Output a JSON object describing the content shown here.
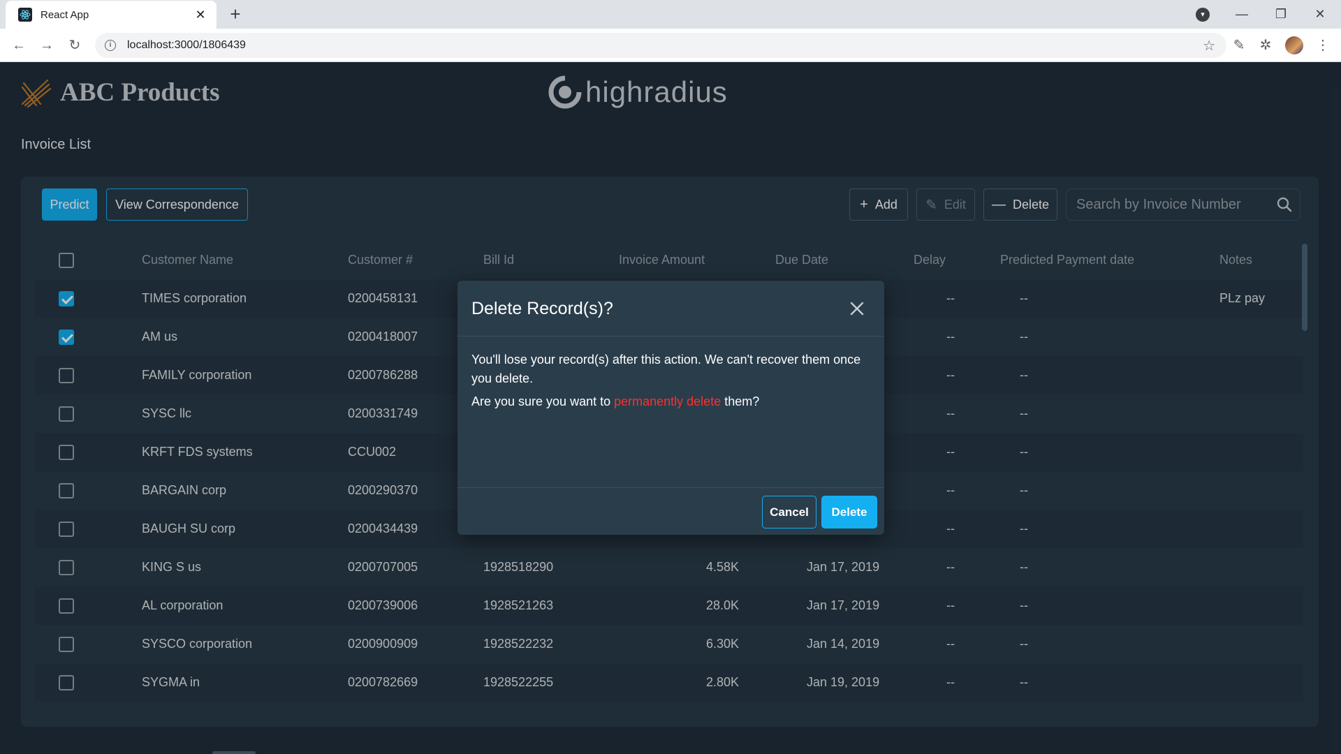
{
  "browser": {
    "tab_title": "React App",
    "url": "localhost:3000/1806439"
  },
  "app": {
    "company_name": "ABC Products",
    "partner_logo_text": "highradius",
    "page_title": "Invoice List"
  },
  "toolbar": {
    "predict_label": "Predict",
    "view_correspondence_label": "View Correspondence",
    "add_label": "Add",
    "edit_label": "Edit",
    "delete_label": "Delete",
    "search_placeholder": "Search by Invoice Number"
  },
  "table": {
    "headers": {
      "customer_name": "Customer Name",
      "customer_number": "Customer #",
      "bill_id": "Bill Id",
      "invoice_amount": "Invoice Amount",
      "due_date": "Due Date",
      "delay": "Delay",
      "predicted_payment_date": "Predicted Payment date",
      "notes": "Notes"
    },
    "rows": [
      {
        "checked": true,
        "customer_name": "TIMES corporation",
        "customer_number": "0200458131",
        "bill_id": "",
        "amount": "",
        "due_date": "",
        "delay": "--",
        "predicted": "--",
        "notes": "PLz pay"
      },
      {
        "checked": true,
        "customer_name": "AM us",
        "customer_number": "0200418007",
        "bill_id": "",
        "amount": "",
        "due_date": "",
        "delay": "--",
        "predicted": "--",
        "notes": ""
      },
      {
        "checked": false,
        "customer_name": "FAMILY corporation",
        "customer_number": "0200786288",
        "bill_id": "",
        "amount": "",
        "due_date": "",
        "delay": "--",
        "predicted": "--",
        "notes": ""
      },
      {
        "checked": false,
        "customer_name": "SYSC llc",
        "customer_number": "0200331749",
        "bill_id": "",
        "amount": "",
        "due_date": "",
        "delay": "--",
        "predicted": "--",
        "notes": ""
      },
      {
        "checked": false,
        "customer_name": "KRFT FDS systems",
        "customer_number": "CCU002",
        "bill_id": "",
        "amount": "",
        "due_date": "",
        "delay": "--",
        "predicted": "--",
        "notes": ""
      },
      {
        "checked": false,
        "customer_name": "BARGAIN corp",
        "customer_number": "0200290370",
        "bill_id": "",
        "amount": "",
        "due_date": "",
        "delay": "--",
        "predicted": "--",
        "notes": ""
      },
      {
        "checked": false,
        "customer_name": "BAUGH SU corp",
        "customer_number": "0200434439",
        "bill_id": "",
        "amount": "",
        "due_date": "",
        "delay": "--",
        "predicted": "--",
        "notes": ""
      },
      {
        "checked": false,
        "customer_name": "KING S us",
        "customer_number": "0200707005",
        "bill_id": "1928518290",
        "amount": "4.58K",
        "due_date": "Jan 17, 2019",
        "delay": "--",
        "predicted": "--",
        "notes": ""
      },
      {
        "checked": false,
        "customer_name": "AL corporation",
        "customer_number": "0200739006",
        "bill_id": "1928521263",
        "amount": "28.0K",
        "due_date": "Jan 17, 2019",
        "delay": "--",
        "predicted": "--",
        "notes": ""
      },
      {
        "checked": false,
        "customer_name": "SYSCO corporation",
        "customer_number": "0200900909",
        "bill_id": "1928522232",
        "amount": "6.30K",
        "due_date": "Jan 14, 2019",
        "delay": "--",
        "predicted": "--",
        "notes": ""
      },
      {
        "checked": false,
        "customer_name": "SYGMA in",
        "customer_number": "0200782669",
        "bill_id": "1928522255",
        "amount": "2.80K",
        "due_date": "Jan 19, 2019",
        "delay": "--",
        "predicted": "--",
        "notes": ""
      }
    ]
  },
  "modal": {
    "title": "Delete Record(s)?",
    "message": "You'll lose your record(s) after this action. We can't recover them once you delete.",
    "question_prefix": "Are you sure you want to ",
    "question_emphasis": "permanently delete",
    "question_suffix": " them?",
    "cancel_label": "Cancel",
    "confirm_label": "Delete"
  },
  "colors": {
    "accent": "#14aff1",
    "background": "#1f2e3b",
    "card": "#283a48",
    "danger": "#ff2f2f"
  }
}
